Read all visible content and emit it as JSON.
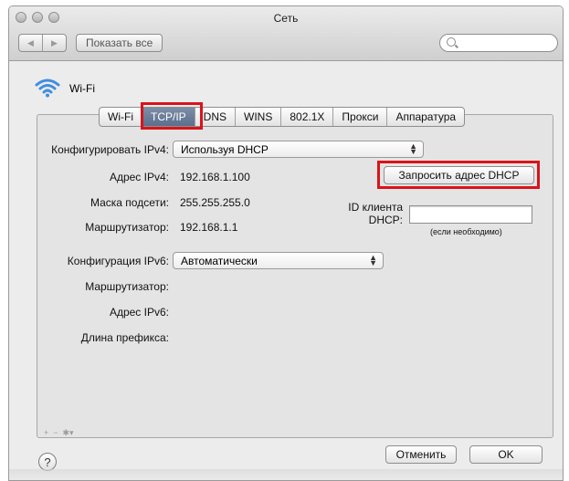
{
  "window": {
    "title": "Сеть"
  },
  "toolbar": {
    "show_all_label": "Показать все",
    "search_placeholder": ""
  },
  "service": {
    "name": "Wi-Fi",
    "icon": "wifi-icon"
  },
  "tabs": [
    {
      "label": "Wi-Fi",
      "active": false
    },
    {
      "label": "TCP/IP",
      "active": true
    },
    {
      "label": "DNS",
      "active": false
    },
    {
      "label": "WINS",
      "active": false
    },
    {
      "label": "802.1X",
      "active": false
    },
    {
      "label": "Прокси",
      "active": false
    },
    {
      "label": "Аппаратура",
      "active": false
    }
  ],
  "ipv4": {
    "configure_label": "Конфигурировать IPv4:",
    "configure_value": "Используя DHCP",
    "address_label": "Адрес IPv4:",
    "address_value": "192.168.1.100",
    "mask_label": "Маска подсети:",
    "mask_value": "255.255.255.0",
    "router_label": "Маршрутизатор:",
    "router_value": "192.168.1.1",
    "renew_button": "Запросить адрес DHCP",
    "client_id_label_1": "ID клиента",
    "client_id_label_2": "DHCP:",
    "client_id_value": "",
    "client_id_hint": "(если необходимо)"
  },
  "ipv6": {
    "configure_label": "Конфигурация IPv6:",
    "configure_value": "Автоматически",
    "router_label": "Маршрутизатор:",
    "address_label": "Адрес IPv6:",
    "prefix_label": "Длина префикса:"
  },
  "footer": {
    "help_label": "?",
    "cancel_label": "Отменить",
    "ok_label": "OK"
  },
  "colors": {
    "highlight": "#d8141b",
    "active_tab": "#6a7d9a",
    "window_bg": "#ececec"
  }
}
